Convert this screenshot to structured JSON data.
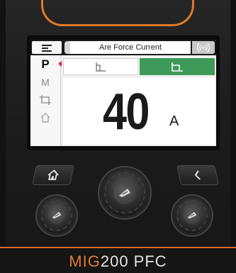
{
  "header": {
    "title": "Are Force Current"
  },
  "sidebar": {
    "items": [
      {
        "label": "P",
        "icon": "program-icon",
        "active": true
      },
      {
        "label": "M",
        "icon": "memory-icon",
        "active": false
      },
      {
        "label": "",
        "icon": "crop-icon",
        "active": false
      },
      {
        "label": "",
        "icon": "home-outline-icon",
        "active": false
      }
    ]
  },
  "tabs": [
    {
      "icon": "mode-outline-icon",
      "selected": false
    },
    {
      "icon": "mode-filled-icon",
      "selected": true
    }
  ],
  "display": {
    "value": "40",
    "unit": "A"
  },
  "model": {
    "prefix": "MIG",
    "suffix": "200 PFC"
  },
  "colors": {
    "accent_orange": "#e07a26",
    "tab_selected_green": "#3d9a58",
    "active_marker_red": "#e02020"
  }
}
